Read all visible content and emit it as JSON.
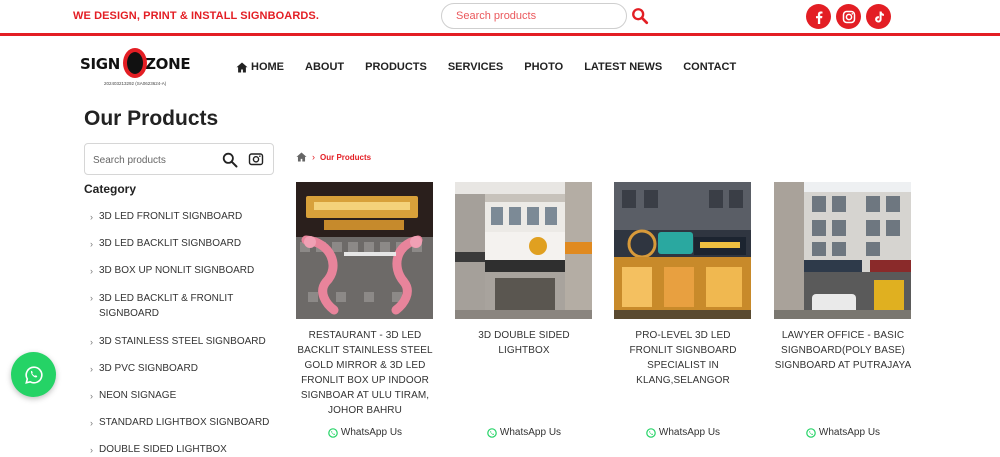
{
  "topbar": {
    "tagline": "WE DESIGN, PRINT & INSTALL SIGNBOARDS.",
    "search_placeholder": "Search products",
    "social": [
      "facebook-icon",
      "instagram-icon",
      "tiktok-icon"
    ]
  },
  "logo": {
    "text_left": "SIGN",
    "text_right": "ZONE",
    "subline": "202403213292 (SA0623624-A)"
  },
  "nav": {
    "items": [
      "HOME",
      "ABOUT",
      "PRODUCTS",
      "SERVICES",
      "PHOTO",
      "LATEST NEWS",
      "CONTACT"
    ]
  },
  "sidebar": {
    "page_title": "Our Products",
    "search_placeholder": "Search products",
    "category_title": "Category",
    "categories": [
      "3D LED FRONLIT SIGNBOARD",
      "3D LED BACKLIT SIGNBOARD",
      "3D BOX UP NONLIT SIGNBOARD",
      "3D LED BACKLIT & FRONLIT SIGNBOARD",
      "3D STAINLESS STEEL SIGNBOARD",
      "3D PVC SIGNBOARD",
      "NEON SIGNAGE",
      "STANDARD LIGHTBOX SIGNBOARD",
      "DOUBLE SIDED LIGHTBOX"
    ]
  },
  "breadcrumb": {
    "current": "Our Products"
  },
  "products": [
    {
      "title": "RESTAURANT - 3D LED BACKLIT STAINLESS STEEL GOLD MIRROR & 3D LED FRONLIT BOX UP INDOOR SIGNBOAR AT ULU TIRAM, JOHOR BAHRU",
      "cta": "WhatsApp Us"
    },
    {
      "title": "3D DOUBLE SIDED LIGHTBOX",
      "cta": "WhatsApp Us"
    },
    {
      "title": "PRO-LEVEL 3D LED FRONLIT SIGNBOARD SPECIALIST IN KLANG,SELANGOR",
      "cta": "WhatsApp Us"
    },
    {
      "title": "LAWYER OFFICE - BASIC SIGNBOARD(POLY BASE) SIGNBOARD AT PUTRAJAYA",
      "cta": "WhatsApp Us"
    }
  ],
  "colors": {
    "brand_red": "#e31e24",
    "whatsapp_green": "#25d366"
  }
}
